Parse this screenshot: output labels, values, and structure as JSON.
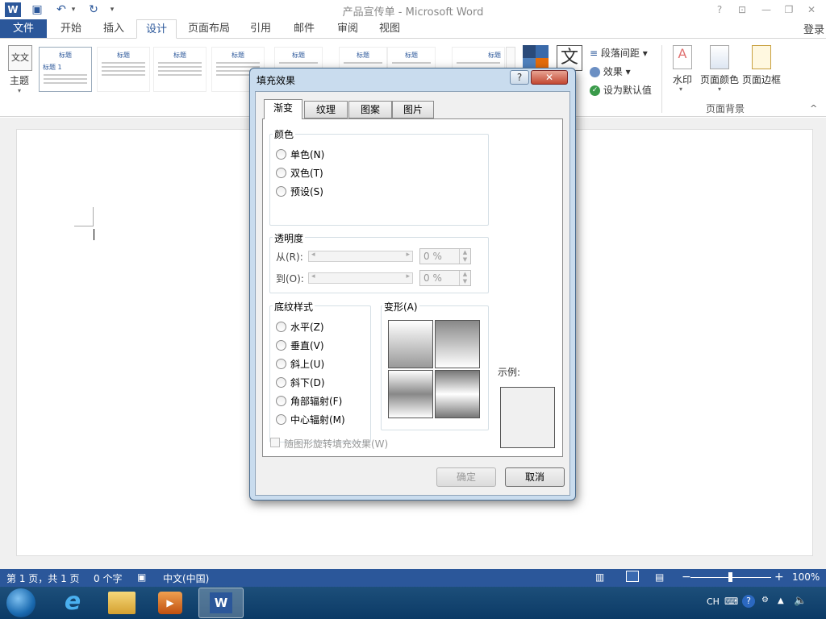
{
  "window": {
    "title": "产品宣传单 - Microsoft Word",
    "login": "登录",
    "help_btn": "?",
    "ribbon_opts_btn": "⊡",
    "min_btn": "—",
    "max_btn": "❐",
    "close_btn": "✕"
  },
  "quickaccess": {
    "word_icon": "W",
    "save": "▣",
    "undo": "↶",
    "redo": "↻",
    "more": "▾"
  },
  "tabs": {
    "file": "文件",
    "home": "开始",
    "insert": "插入",
    "design": "设计",
    "layout": "页面布局",
    "references": "引用",
    "mailings": "邮件",
    "review": "审阅",
    "view": "视图"
  },
  "ribbon": {
    "theme": "主题",
    "theme_icon": "文文",
    "gallery": [
      "标题",
      "标题",
      "标题",
      "标题",
      "标题",
      "标题",
      "标题",
      "标题"
    ],
    "gallery_heading1": "标题 1",
    "char_wen": "文",
    "para_spacing": "段落间距",
    "effects": "效果",
    "set_default": "设为默认值",
    "watermark": "水印",
    "page_color": "页面颜色",
    "page_border": "页面边框",
    "page_bg_group": "页面背景",
    "collapse": "^"
  },
  "dialog": {
    "title": "填充效果",
    "help": "?",
    "close": "✕",
    "tabs": [
      "渐变",
      "纹理",
      "图案",
      "图片"
    ],
    "color_group": "颜色",
    "color_options": [
      "单色(N)",
      "双色(T)",
      "预设(S)"
    ],
    "transparency_group": "透明度",
    "from_label": "从(R):",
    "to_label": "到(O):",
    "from_value": "0 %",
    "to_value": "0 %",
    "shading_group": "底纹样式",
    "shading_options": [
      "水平(Z)",
      "垂直(V)",
      "斜上(U)",
      "斜下(D)",
      "角部辐射(F)",
      "中心辐射(M)"
    ],
    "variants_group": "变形(A)",
    "sample_label": "示例:",
    "rotate_checkbox": "随图形旋转填充效果(W)",
    "ok": "确定",
    "cancel": "取消"
  },
  "status": {
    "page": "第 1 页，共 1 页",
    "words": "0 个字",
    "lang": "中文(中国)",
    "zoom": "100%",
    "zoom_minus": "−",
    "zoom_plus": "+"
  },
  "taskbar": {
    "lang": "CH",
    "ie": "e",
    "word": "W"
  }
}
